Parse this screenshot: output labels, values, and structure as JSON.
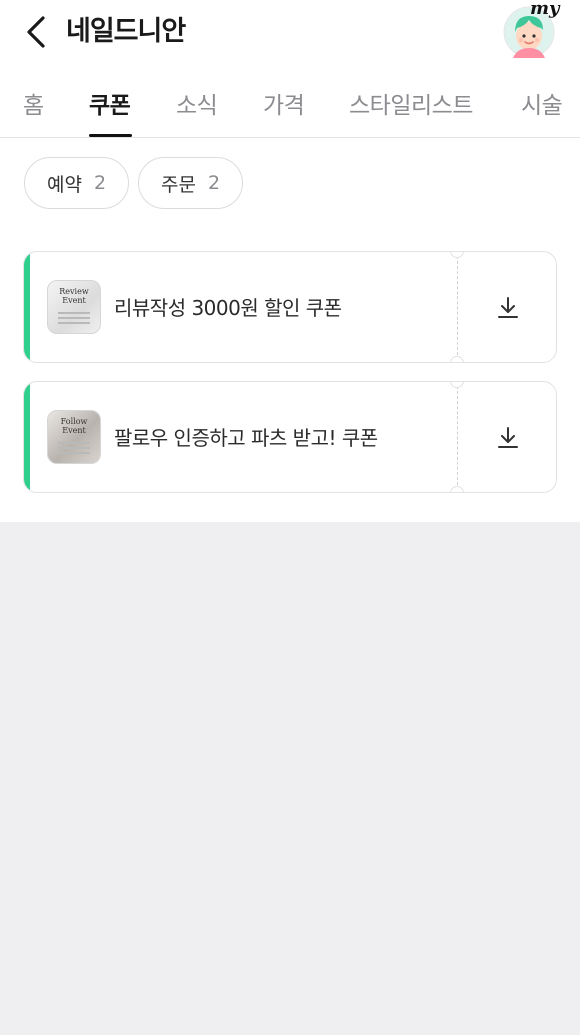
{
  "header": {
    "title": "네일드니안",
    "back_icon": "chevron-left-icon",
    "avatar_badge": "my"
  },
  "tabs": [
    {
      "label": "홈",
      "active": false
    },
    {
      "label": "쿠폰",
      "active": true
    },
    {
      "label": "소식",
      "active": false
    },
    {
      "label": "가격",
      "active": false
    },
    {
      "label": "스타일리스트",
      "active": false
    },
    {
      "label": "시술",
      "active": false
    }
  ],
  "filters": [
    {
      "label": "예약",
      "count": "2"
    },
    {
      "label": "주문",
      "count": "2"
    }
  ],
  "coupons": [
    {
      "title": "리뷰작성 3000원 할인 쿠폰",
      "thumb_text": "Review Event",
      "download_icon": "download-icon"
    },
    {
      "title": "팔로우 인증하고 파츠 받고! 쿠폰",
      "thumb_text": "Follow Event",
      "download_icon": "download-icon"
    }
  ],
  "colors": {
    "accent": "#2fcf8d",
    "background": "#efeff1",
    "active_tab": "#1a1a1a",
    "inactive_tab": "#8b8b90"
  }
}
